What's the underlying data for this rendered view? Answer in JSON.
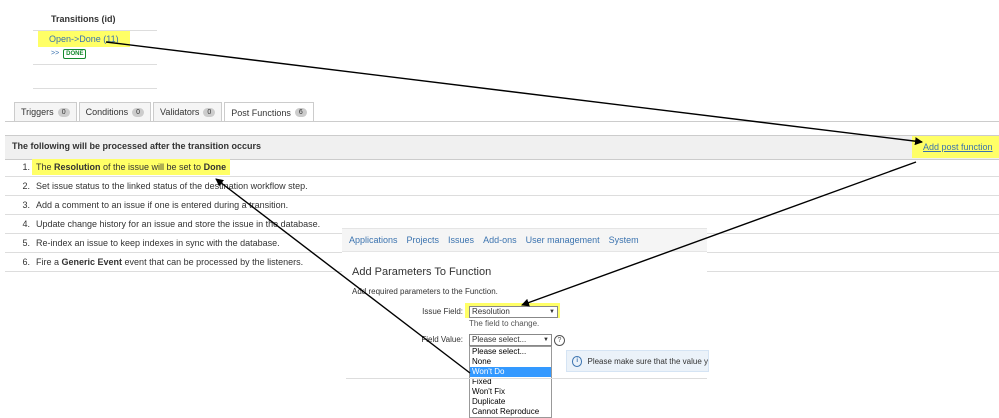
{
  "transitions": {
    "title": "Transitions (id)",
    "link": "Open->Done (11)",
    "prefix": ">>",
    "status": "DONE"
  },
  "tabs": [
    {
      "label": "Triggers",
      "count": "0"
    },
    {
      "label": "Conditions",
      "count": "0"
    },
    {
      "label": "Validators",
      "count": "0"
    },
    {
      "label": "Post Functions",
      "count": "6"
    }
  ],
  "section": {
    "title": "The following will be processed after the transition occurs",
    "add_link": "Add post function"
  },
  "steps": [
    {
      "num": "1.",
      "pre": "The ",
      "b1": "Resolution",
      "mid": " of the issue will be set to ",
      "b2": "Done"
    },
    {
      "num": "2.",
      "text": "Set issue status to the linked status of the destination workflow step."
    },
    {
      "num": "3.",
      "text": "Add a comment to an issue if one is entered during a transition."
    },
    {
      "num": "4.",
      "text": "Update change history for an issue and store the issue in the database."
    },
    {
      "num": "5.",
      "text": "Re-index an issue to keep indexes in sync with the database."
    },
    {
      "num": "6.",
      "pre": "Fire a ",
      "b1": "Generic Event",
      "post": " event that can be processed by the listeners."
    }
  ],
  "admin_menu": [
    "Applications",
    "Projects",
    "Issues",
    "Add-ons",
    "User management",
    "System"
  ],
  "function_form": {
    "title": "Add Parameters To Function",
    "description": "Add required parameters to the Function.",
    "issue_field_label": "Issue Field:",
    "issue_field_value": "Resolution",
    "issue_field_hint": "The field to change.",
    "field_value_label": "Field Value:",
    "field_value_selected": "Please select...",
    "options": [
      "Please select...",
      "None",
      "Won't Do",
      "Fixed",
      "Won't Fix",
      "Duplicate",
      "Cannot Reproduce"
    ],
    "highlighted_option": "Won't Do",
    "help_glyph": "?",
    "info_text": "Please make sure that the value y",
    "info_glyph": "i"
  },
  "colors": {
    "highlight": "#ffff66",
    "link": "#3b73af",
    "done_green": "#14892c",
    "option_selected": "#3399ff"
  }
}
